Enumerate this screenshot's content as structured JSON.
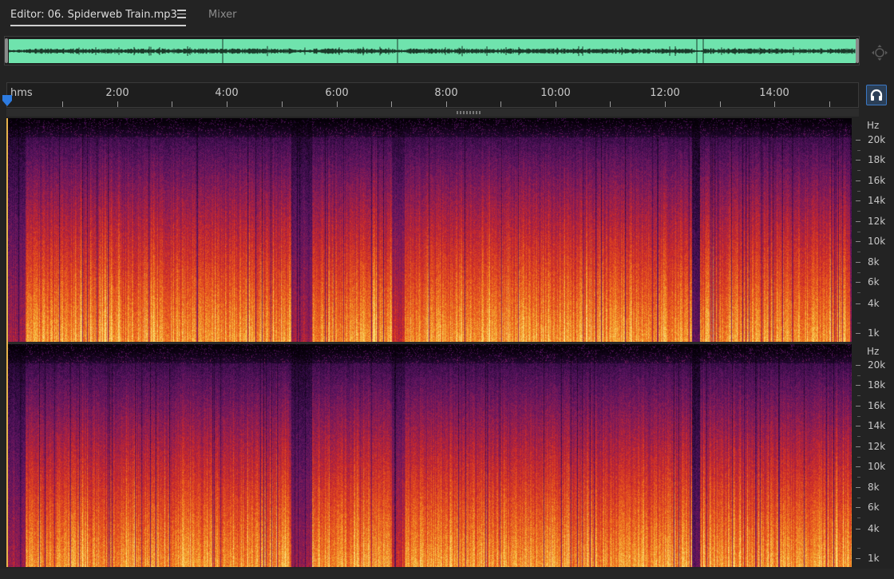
{
  "tabs": {
    "editor_label": "Editor: 06. Spiderweb Train.mp3",
    "mixer_label": "Mixer"
  },
  "colors": {
    "overview_waveform": "#6fe3ad",
    "accent": "#3b78c4",
    "spectrogram_palette": [
      "#050007",
      "#2b0a3d",
      "#5a1460",
      "#8f1d52",
      "#c8282c",
      "#e8561c",
      "#f5a22c",
      "#fbe07a"
    ]
  },
  "ruler": {
    "unit": "hms",
    "labels": [
      "2:00",
      "4:00",
      "6:00",
      "8:00",
      "10:00",
      "12:00",
      "14:00"
    ],
    "duration_seconds": 930
  },
  "freq_scale": {
    "unit": "Hz",
    "labels": [
      "20k",
      "18k",
      "16k",
      "14k",
      "12k",
      "10k",
      "8k",
      "6k",
      "4k",
      "1k"
    ]
  },
  "icons": {
    "menu": "hamburger-menu-icon",
    "zoom_navigator": "zoom-navigator-icon",
    "playhead": "playhead-marker-icon",
    "monitor": "headphones-icon"
  }
}
